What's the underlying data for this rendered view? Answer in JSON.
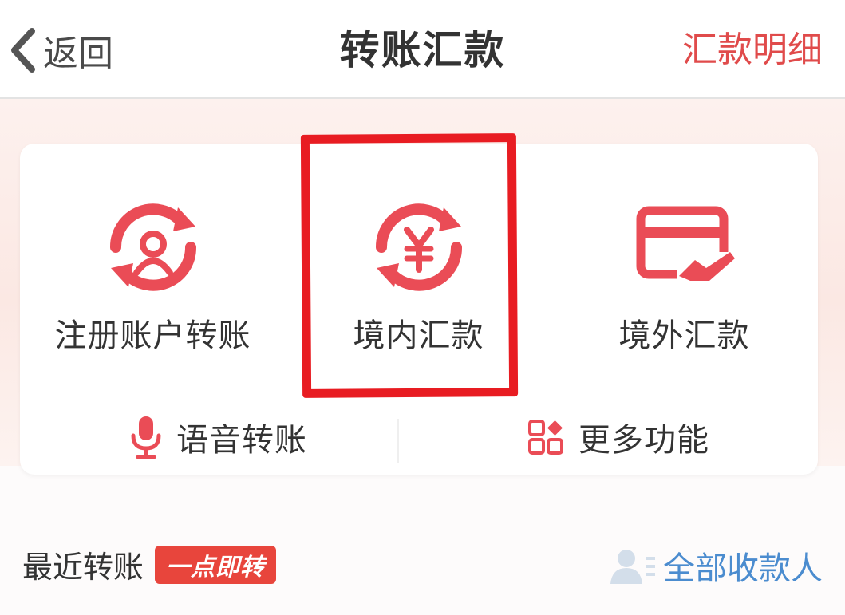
{
  "header": {
    "back_label": "返回",
    "title": "转账汇款",
    "details_link": "汇款明细"
  },
  "features": [
    {
      "label": "注册账户转账",
      "icon": "person-transfer-icon"
    },
    {
      "label": "境内汇款",
      "icon": "yuan-transfer-icon"
    },
    {
      "label": "境外汇款",
      "icon": "card-plane-icon"
    }
  ],
  "quick": [
    {
      "label": "语音转账",
      "icon": "microphone-icon"
    },
    {
      "label": "更多功能",
      "icon": "grid-icon"
    }
  ],
  "recent": {
    "title": "最近转账",
    "badge": "一点即转",
    "all_payees": "全部收款人"
  },
  "colors": {
    "accent": "#e8453c",
    "highlight_box": "#e81c22",
    "link_blue": "#4b8ccf"
  }
}
